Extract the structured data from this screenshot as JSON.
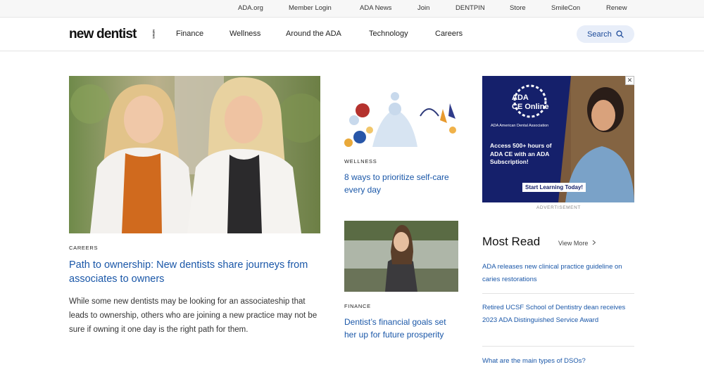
{
  "utility_nav": {
    "links": [
      "ADA.org",
      "Member Login",
      "ADA News",
      "Join",
      "DENTPIN",
      "Store",
      "SmileCon",
      "Renew"
    ]
  },
  "header": {
    "logo_text": "new dentist",
    "logo_sub": "NEWS",
    "nav": [
      "Finance",
      "Wellness",
      "Around the ADA",
      "Technology",
      "Careers"
    ],
    "search_label": "Search",
    "search_icon": "magnifier-icon"
  },
  "feature": {
    "kicker": "CAREERS",
    "title": "Path to ownership: New dentists share journeys from associates to owners",
    "excerpt": "While some new dentists may be looking for an associateship that leads to ownership, others who are joining a new practice may not be sure if owning it one day is the right path for them."
  },
  "story1": {
    "kicker": "WELLNESS",
    "title": "8 ways to prioritize self-care every day"
  },
  "story2": {
    "kicker": "FINANCE",
    "title": "Dentist’s financial goals set her up for future prosperity"
  },
  "ad": {
    "brand_line1": "ADA",
    "brand_line2": "CE Online",
    "assoc": "ADA American Dental Association",
    "body": "Access 500+ hours of ADA CE with an ADA Subscription!",
    "cta": "Start Learning Today!",
    "label": "ADVERTISEMENT",
    "close": "✕"
  },
  "most_read": {
    "title": "Most Read",
    "view_more": "View More",
    "items": [
      "ADA releases new clinical practice guideline on caries restorations",
      "Retired UCSF School of Dentistry dean receives 2023 ADA Distinguished Service Award",
      "What are the main types of DSOs?"
    ]
  },
  "colors": {
    "link_blue": "#1a57a8",
    "ad_navy": "#15206b",
    "search_bg": "#e8eef9"
  }
}
